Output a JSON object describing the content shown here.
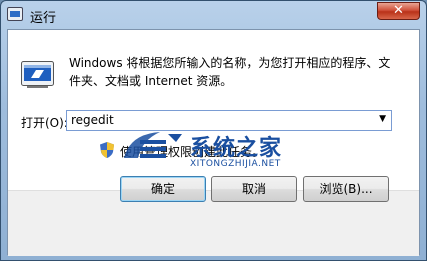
{
  "window": {
    "title": "运行",
    "close_label": "✕"
  },
  "dialog": {
    "description": "Windows 将根据您所输入的名称，为您打开相应的程序、文件夹、文档或 Internet 资源。",
    "open_label": "打开(O):",
    "open_value": "regedit",
    "admin_note": "使用管理权限创建此任务。"
  },
  "buttons": {
    "ok": "确定",
    "cancel": "取消",
    "browse": "浏览(B)..."
  },
  "watermark": {
    "title": "系统之家",
    "url": "XITONGZHIJIA.NET"
  },
  "icons": {
    "app": "run-icon",
    "shield": "uac-shield-icon",
    "dropdown": "chevron-down-icon"
  }
}
